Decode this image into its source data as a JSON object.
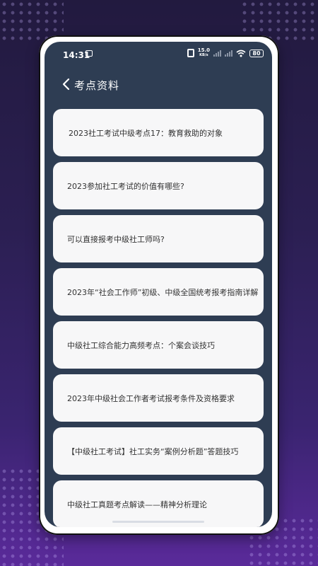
{
  "status_bar": {
    "time": "14:31",
    "net_speed_value": "15.0",
    "net_speed_unit": "KB/s",
    "battery": "80"
  },
  "nav": {
    "title": "考点资料"
  },
  "articles": [
    "2023社工考试中级考点17：教育救助的对象",
    "2023参加社工考试的价值有哪些?",
    "可以直接报考中级社工师吗?",
    "2023年“社会工作师”初级、中级全国统考报考指南详解",
    "中级社工综合能力高频考点：个案会谈技巧",
    "2023年中级社会工作者考试报考条件及资格要求",
    "【中级社工考试】社工实务“案例分析题”答题技巧",
    "中级社工真题考点解读——精神分析理论"
  ],
  "colors": {
    "screen_bg": "#2e3d53",
    "card_bg": "#f7f7f8",
    "page_bg": "#2b1f52"
  },
  "icons": {
    "back": "chevron-left-icon",
    "message": "message-icon",
    "vibrate": "vibrate-icon",
    "signal": "signal-icon",
    "wifi": "wifi-icon",
    "battery": "battery-icon"
  }
}
